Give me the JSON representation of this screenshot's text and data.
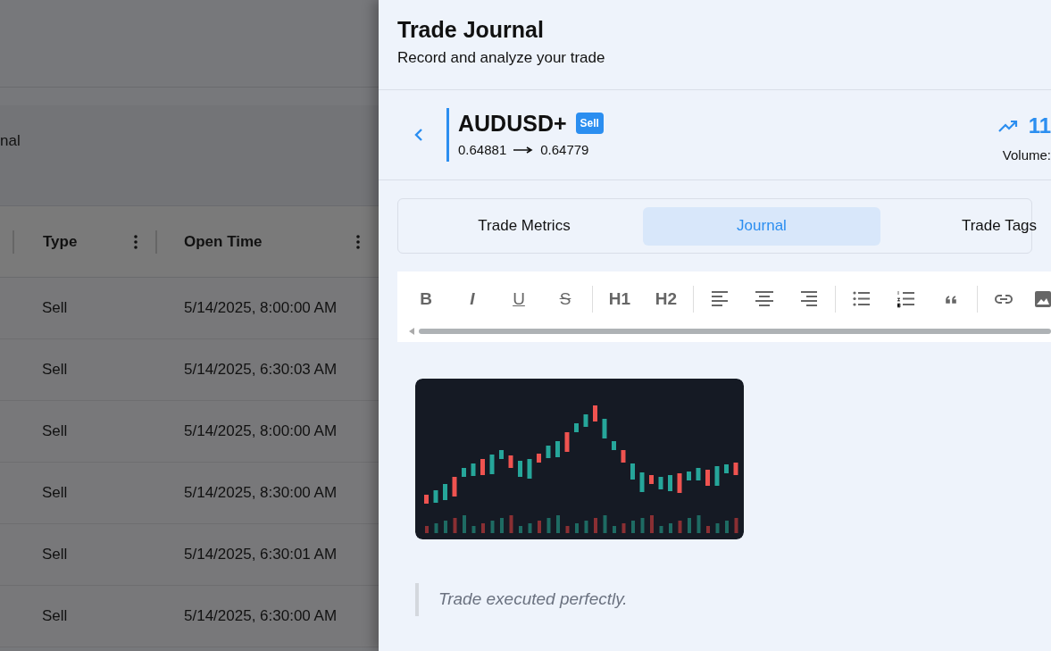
{
  "background_page": {
    "section_label": "nal",
    "columns": [
      "Type",
      "Open Time"
    ],
    "rows": [
      {
        "type": "Sell",
        "open_time": "5/14/2025, 8:00:00 AM"
      },
      {
        "type": "Sell",
        "open_time": "5/14/2025, 6:30:03 AM"
      },
      {
        "type": "Sell",
        "open_time": "5/14/2025, 8:00:00 AM"
      },
      {
        "type": "Sell",
        "open_time": "5/14/2025, 8:30:00 AM"
      },
      {
        "type": "Sell",
        "open_time": "5/14/2025, 6:30:01 AM"
      },
      {
        "type": "Sell",
        "open_time": "5/14/2025, 6:30:00 AM"
      }
    ]
  },
  "drawer": {
    "title": "Trade Journal",
    "subtitle": "Record and analyze your trade",
    "trade": {
      "symbol": "AUDUSD+",
      "side": "Sell",
      "open_price": "0.64881",
      "close_price": "0.64779",
      "profit": "11",
      "volume_label": "Volume:"
    },
    "tabs": [
      {
        "label": "Trade Metrics",
        "selected": false
      },
      {
        "label": "Journal",
        "selected": true
      },
      {
        "label": "Trade Tags",
        "selected": false
      }
    ],
    "toolbar": [
      {
        "kind": "bold",
        "label": "B"
      },
      {
        "kind": "italic",
        "label": "I"
      },
      {
        "kind": "underline",
        "label": "U"
      },
      {
        "kind": "strike",
        "label": "S"
      },
      {
        "kind": "divider"
      },
      {
        "kind": "heading",
        "label": "H1"
      },
      {
        "kind": "heading",
        "label": "H2"
      },
      {
        "kind": "divider"
      },
      {
        "kind": "align-left"
      },
      {
        "kind": "align-center"
      },
      {
        "kind": "align-right"
      },
      {
        "kind": "divider"
      },
      {
        "kind": "bullet-list"
      },
      {
        "kind": "ordered-list"
      },
      {
        "kind": "quote"
      },
      {
        "kind": "divider"
      },
      {
        "kind": "link"
      },
      {
        "kind": "image"
      }
    ],
    "quote": "Trade executed perfectly."
  }
}
